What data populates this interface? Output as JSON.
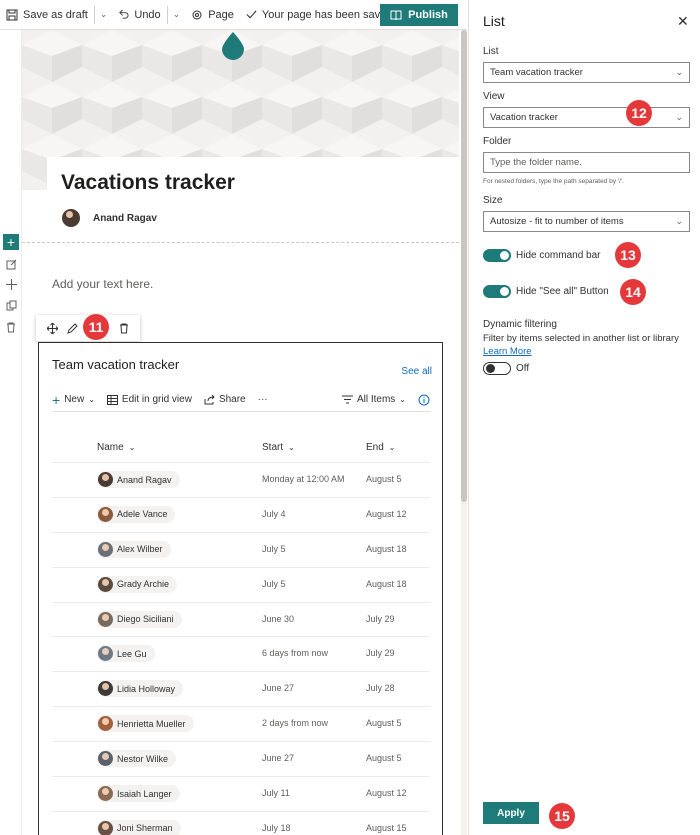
{
  "toolbar": {
    "save_draft": "Save as draft",
    "undo": "Undo",
    "page": "Page",
    "status": "Your page has been saved",
    "publish": "Publish"
  },
  "page": {
    "title": "Vacations tracker",
    "author": "Anand Ragav",
    "text_placeholder": "Add your text here."
  },
  "callouts": {
    "c11": "11",
    "c12": "12",
    "c13": "13",
    "c14": "14",
    "c15": "15"
  },
  "list_webpart": {
    "title": "Team vacation tracker",
    "see_all": "See all",
    "commands": {
      "new": "New",
      "grid": "Edit in grid view",
      "share": "Share",
      "more": "···",
      "view": "All Items"
    },
    "columns": {
      "name": "Name",
      "start": "Start",
      "end": "End"
    },
    "rows": [
      {
        "name": "Anand Ragav",
        "start": "Monday at 12:00 AM",
        "end": "August 5",
        "color": "#4a3b33"
      },
      {
        "name": "Adele Vance",
        "start": "July 4",
        "end": "August 12",
        "color": "#8c5a3c"
      },
      {
        "name": "Alex Wilber",
        "start": "July 5",
        "end": "August 18",
        "color": "#6b6f77"
      },
      {
        "name": "Grady Archie",
        "start": "July 5",
        "end": "August 18",
        "color": "#5b4a3f"
      },
      {
        "name": "Diego Siciliani",
        "start": "June 30",
        "end": "July 29",
        "color": "#7a6a5e"
      },
      {
        "name": "Lee Gu",
        "start": "6 days from now",
        "end": "July 29",
        "color": "#6d7a86"
      },
      {
        "name": "Lidia Holloway",
        "start": "June 27",
        "end": "July 28",
        "color": "#3e3a3a"
      },
      {
        "name": "Henrietta Mueller",
        "start": "2 days from now",
        "end": "August 5",
        "color": "#a0603f"
      },
      {
        "name": "Nestor Wilke",
        "start": "June 27",
        "end": "August 5",
        "color": "#59616b"
      },
      {
        "name": "Isaiah Langer",
        "start": "July 11",
        "end": "August 12",
        "color": "#8a6a52"
      },
      {
        "name": "Joni Sherman",
        "start": "July 18",
        "end": "August 15",
        "color": "#6a4f44"
      }
    ]
  },
  "pane": {
    "title": "List",
    "list_label": "List",
    "list_value": "Team vacation tracker",
    "view_label": "View",
    "view_value": "Vacation tracker",
    "folder_label": "Folder",
    "folder_placeholder": "Type the folder name.",
    "folder_hint": "For nested folders, type the path separated by '/'.",
    "size_label": "Size",
    "size_value": "Autosize - fit to number of items",
    "hide_command_bar": "Hide command bar",
    "hide_see_all": "Hide \"See all\" Button",
    "dynamic_title": "Dynamic filtering",
    "dynamic_desc": "Filter by items selected in another list or library",
    "learn_more": "Learn More",
    "dynamic_state": "Off",
    "apply": "Apply"
  },
  "colors": {
    "accent": "#1f7a7a",
    "callout": "#e5383b",
    "link": "#0f6cbd"
  }
}
